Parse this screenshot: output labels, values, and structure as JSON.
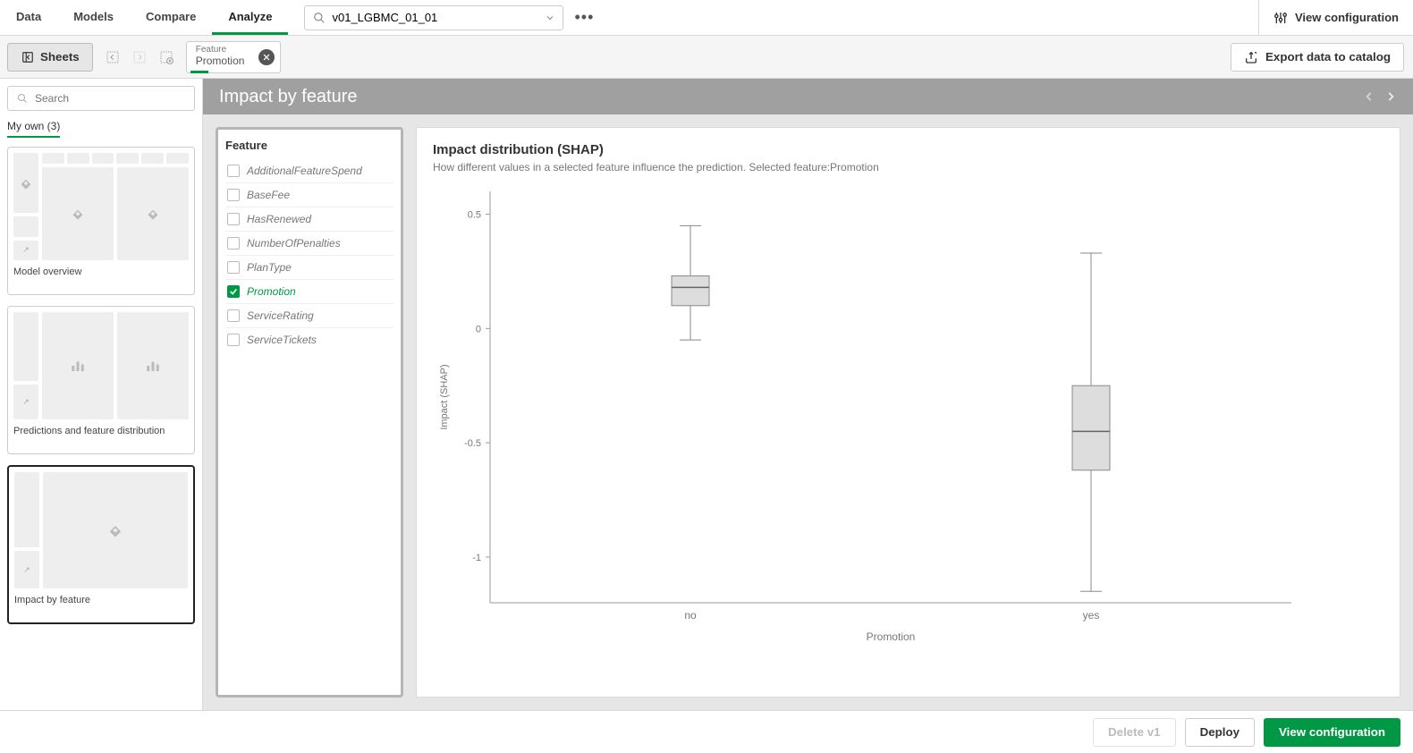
{
  "top_tabs": [
    "Data",
    "Models",
    "Compare",
    "Analyze"
  ],
  "active_top_tab": 3,
  "model_search_value": "v01_LGBMC_01_01",
  "view_configuration": "View configuration",
  "sheets_button": "Sheets",
  "feature_chip": {
    "label": "Feature",
    "value": "Promotion"
  },
  "export_button": "Export data to catalog",
  "side_search_placeholder": "Search",
  "my_own_label": "My own (3)",
  "sheet_thumbs": [
    {
      "caption": "Model overview"
    },
    {
      "caption": "Predictions and feature distribution"
    },
    {
      "caption": "Impact by feature"
    }
  ],
  "active_thumb": 2,
  "ws_title": "Impact by feature",
  "feature_panel_title": "Feature",
  "features": [
    {
      "name": "AdditionalFeatureSpend",
      "selected": false
    },
    {
      "name": "BaseFee",
      "selected": false
    },
    {
      "name": "HasRenewed",
      "selected": false
    },
    {
      "name": "NumberOfPenalties",
      "selected": false
    },
    {
      "name": "PlanType",
      "selected": false
    },
    {
      "name": "Promotion",
      "selected": true
    },
    {
      "name": "ServiceRating",
      "selected": false
    },
    {
      "name": "ServiceTickets",
      "selected": false
    }
  ],
  "chart_title": "Impact distribution (SHAP)",
  "chart_subtitle": "How different values in a selected feature influence the prediction. Selected feature:Promotion",
  "chart_data": {
    "type": "boxplot",
    "title": "Impact distribution (SHAP)",
    "xlabel": "Promotion",
    "ylabel": "Impact (SHAP)",
    "ylim": [
      -1.2,
      0.6
    ],
    "yticks": [
      0.5,
      0,
      -0.5,
      -1
    ],
    "categories": [
      "no",
      "yes"
    ],
    "series": [
      {
        "name": "no",
        "min": -0.05,
        "q1": 0.1,
        "median": 0.18,
        "q3": 0.23,
        "max": 0.45
      },
      {
        "name": "yes",
        "min": -1.15,
        "q1": -0.62,
        "median": -0.45,
        "q3": -0.25,
        "max": 0.33
      }
    ]
  },
  "footer": {
    "delete": "Delete v1",
    "deploy": "Deploy",
    "view_config": "View configuration"
  }
}
